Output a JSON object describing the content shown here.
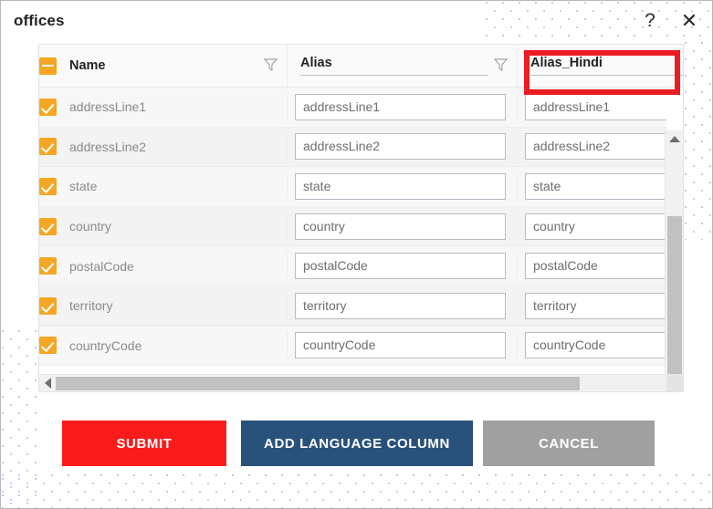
{
  "window": {
    "title": "offices",
    "help_icon": "question-mark-icon",
    "close_icon": "close-icon"
  },
  "table": {
    "columns": [
      {
        "key": "select",
        "label": "",
        "type": "checkbox",
        "header_state": "indeterminate"
      },
      {
        "key": "name",
        "label": "Name",
        "type": "text",
        "filterable": true
      },
      {
        "key": "alias",
        "label": "Alias",
        "type": "editable-header",
        "filterable": true
      },
      {
        "key": "alias_hindi",
        "label": "Alias_Hindi",
        "type": "editable-header",
        "filterable": false,
        "highlighted": true
      }
    ],
    "header": {
      "name_label": "Name",
      "alias_label": "Alias",
      "alias_hindi_label": "Alias_Hindi",
      "filter_icon": "funnel-filter-icon"
    },
    "rows": [
      {
        "checked": true,
        "name": "addressLine1",
        "alias": "addressLine1",
        "alias_hindi": "addressLine1"
      },
      {
        "checked": true,
        "name": "addressLine2",
        "alias": "addressLine2",
        "alias_hindi": "addressLine2"
      },
      {
        "checked": true,
        "name": "state",
        "alias": "state",
        "alias_hindi": "state"
      },
      {
        "checked": true,
        "name": "country",
        "alias": "country",
        "alias_hindi": "country"
      },
      {
        "checked": true,
        "name": "postalCode",
        "alias": "postalCode",
        "alias_hindi": "postalCode"
      },
      {
        "checked": true,
        "name": "territory",
        "alias": "territory",
        "alias_hindi": "territory"
      },
      {
        "checked": true,
        "name": "countryCode",
        "alias": "countryCode",
        "alias_hindi": "countryCode"
      }
    ],
    "scrollbars": {
      "vertical": {
        "up_arrow": "triangle-up-icon",
        "down_arrow": "triangle-down-icon"
      },
      "horizontal": {
        "left_arrow": "triangle-left-icon",
        "right_arrow": "triangle-right-icon"
      }
    }
  },
  "footer": {
    "submit_label": "SUBMIT",
    "add_language_label": "ADD LANGUAGE COLUMN",
    "cancel_label": "CANCEL"
  },
  "colors": {
    "submit": "#fc1b1b",
    "add_language": "#28527c",
    "cancel": "#a0a0a0",
    "checkbox": "#f5a623",
    "highlight": "#ed1c24",
    "dots": "#8c9fe0"
  }
}
